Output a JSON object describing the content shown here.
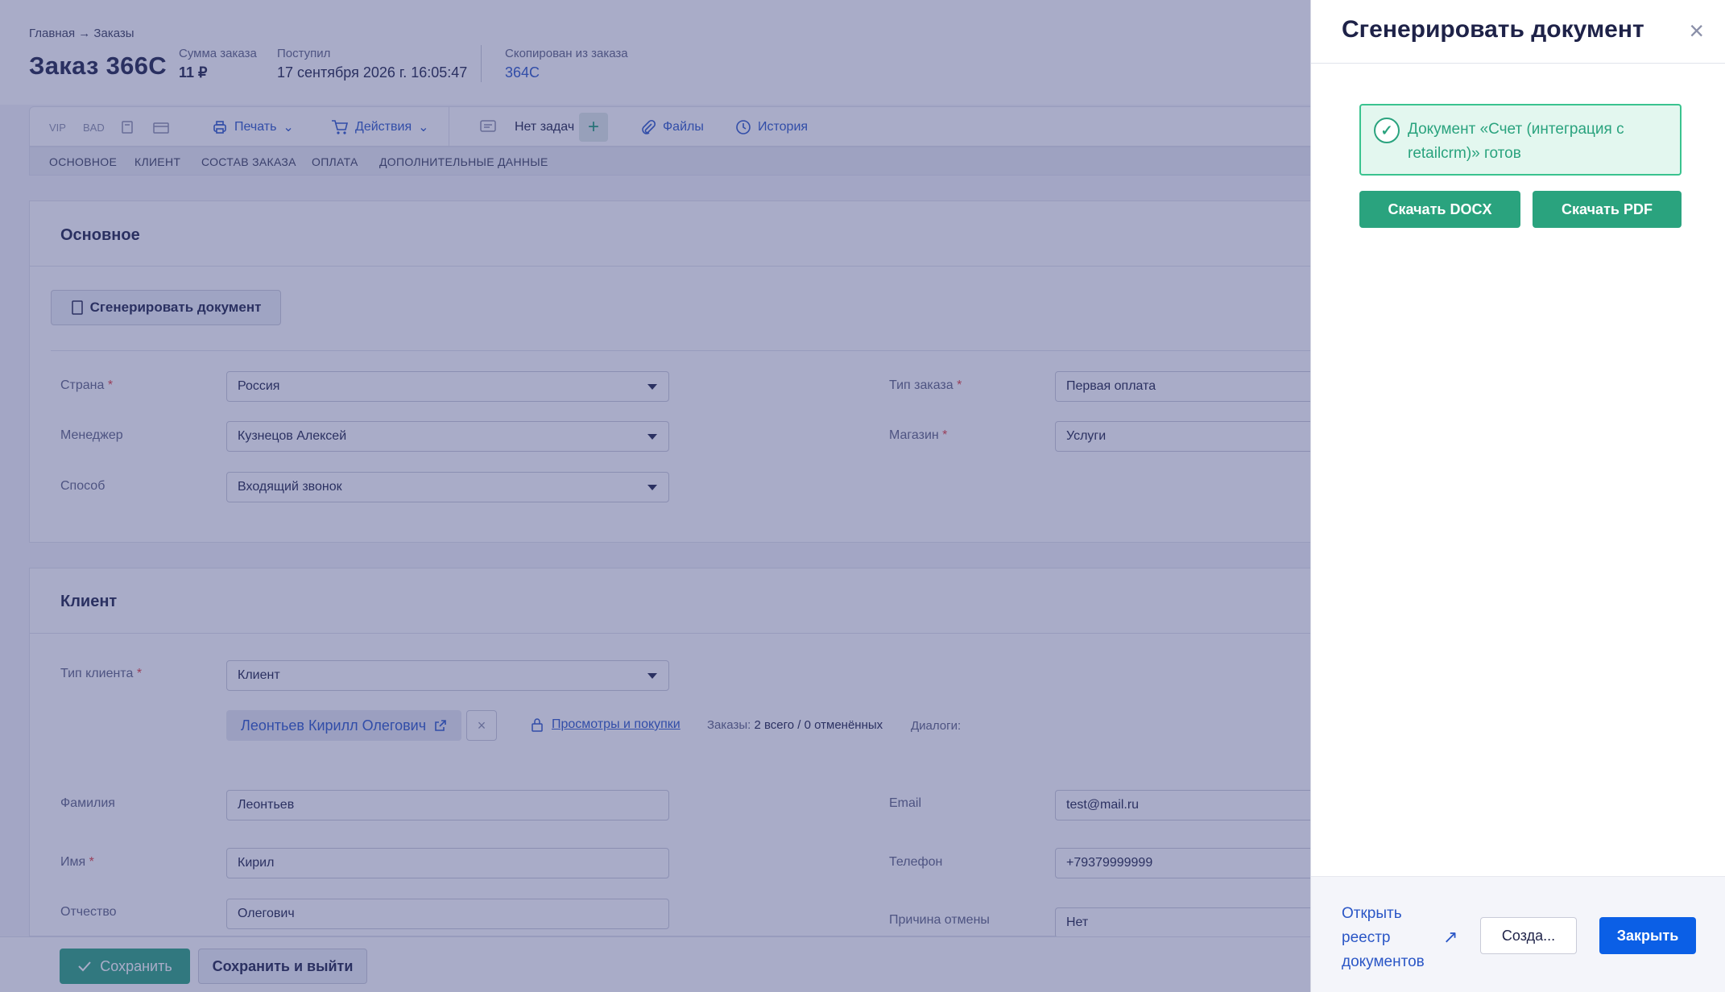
{
  "header": {
    "breadcrumb": "Главная → Заказы",
    "order_title": "Заказ 366С",
    "sum_label": "Сумма заказа",
    "sum_value": "11 ₽",
    "received_label": "Поступил",
    "received_value": "17 сентября 2026 г. 16:05:47",
    "copied_label": "Скопирован из заказа",
    "copied_value": "364С"
  },
  "toolbar": {
    "vip": "VIP",
    "bad": "BAD",
    "print": "Печать",
    "actions": "Действия",
    "no_tasks": "Нет задач",
    "add": "+",
    "files": "Файлы",
    "history": "История"
  },
  "tabs": [
    "ОСНОВНОЕ",
    "КЛИЕНТ",
    "СОСТАВ ЗАКАЗА",
    "ОПЛАТА",
    "ДОПОЛНИТЕЛЬНЫЕ ДАННЫЕ"
  ],
  "main": {
    "title": "Основное",
    "generate_btn": "Сгенерировать документ",
    "country_label": "Страна",
    "country_value": "Россия",
    "manager_label": "Менеджер",
    "manager_value": "Кузнецов Алексей",
    "method_label": "Способ",
    "method_value": "Входящий звонок",
    "order_type_label": "Тип заказа",
    "order_type_value": "Первая оплата",
    "shop_label": "Магазин",
    "shop_value": "Услуги",
    "required_mark": "*"
  },
  "client": {
    "title": "Клиент",
    "client_type_label": "Тип клиента",
    "client_type_value": "Клиент",
    "client_name": "Леонтьев Кирилл Олегович",
    "remove": "×",
    "views_link": "Просмотры и покупки",
    "orders_label": "Заказы:",
    "orders_value": "2 всего / 0 отменённых",
    "dialogs_label": "Диалоги:",
    "lastname_label": "Фамилия",
    "lastname_value": "Леонтьев",
    "firstname_label": "Имя",
    "firstname_value": "Кирил",
    "patronymic_label": "Отчество",
    "patronymic_value": "Олегович",
    "email_label": "Email",
    "email_value": "test@mail.ru",
    "phone_label": "Телефон",
    "phone_value": "+79379999999",
    "cancel_reason_label": "Причина отмены",
    "cancel_reason_value": "Нет"
  },
  "footer": {
    "save": "Сохранить",
    "save_exit": "Сохранить и выйти"
  },
  "panel": {
    "title": "Сгенерировать документ",
    "close_icon": "×",
    "success_text": "Документ «Счет (интеграция с retailcrm)» готов",
    "download_docx": "Скачать DOCX",
    "download_pdf": "Скачать PDF",
    "registry_link": "Открыть реестр документов",
    "create_btn": "Созда...",
    "close_btn": "Закрыть"
  },
  "colors": {
    "accent_green": "#2aa37e",
    "primary_blue": "#0b5fe6",
    "link_blue": "#2a56c6"
  }
}
